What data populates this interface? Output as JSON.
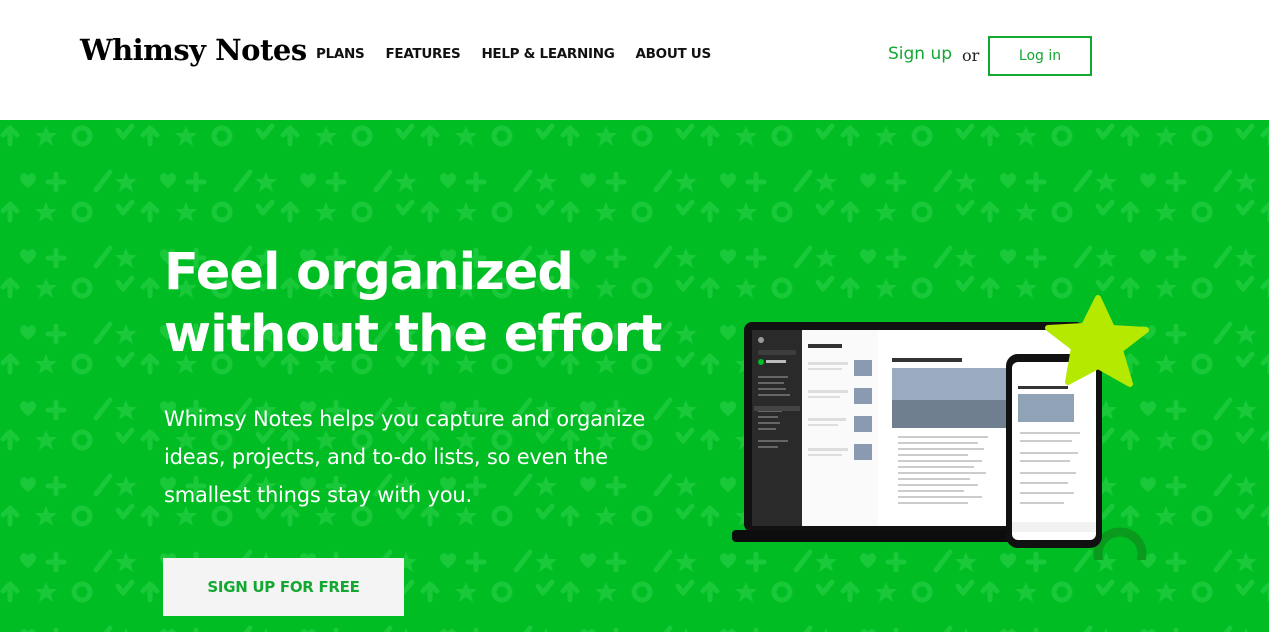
{
  "header": {
    "logo": "Whimsy Notes",
    "nav": [
      "PLANS",
      "FEATURES",
      "HELP & LEARNING",
      "ABOUT US"
    ],
    "signup_label": "Sign up",
    "or_label": "or",
    "login_label": "Log in"
  },
  "hero": {
    "headline_line1": "Feel organized",
    "headline_line2": "without the effort",
    "subtext": "Whimsy Notes helps you capture and organize ideas, projects, and to-do lists, so even the smallest things stay with you.",
    "cta_label": "SIGN UP FOR FREE"
  },
  "colors": {
    "brand_green": "#14a833",
    "hero_bg": "#00bd24",
    "star": "#b5ea00"
  },
  "icons": [
    "star-icon",
    "heart-icon",
    "circle-icon",
    "plus-icon",
    "check-icon",
    "arrow-up-icon"
  ]
}
